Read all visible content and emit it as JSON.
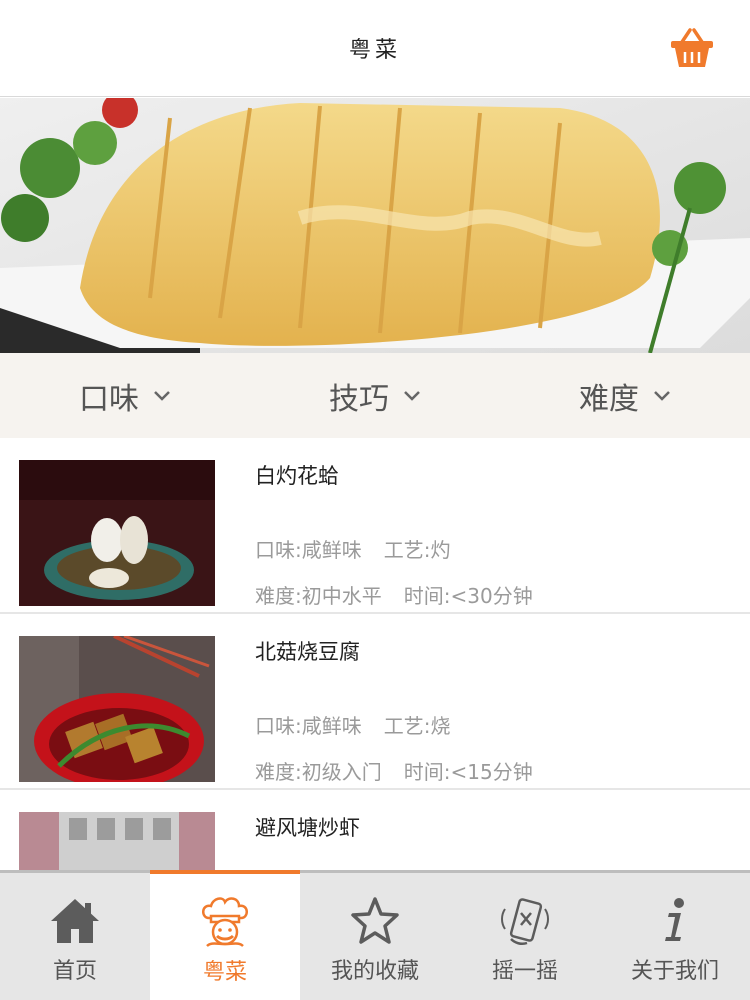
{
  "header": {
    "title": "粤菜",
    "cart_icon": "basket-icon",
    "accent": "#f07a2c"
  },
  "filters": [
    {
      "label": "口味"
    },
    {
      "label": "技巧"
    },
    {
      "label": "难度"
    }
  ],
  "recipes": [
    {
      "name": "白灼花蛤",
      "taste": "口味:咸鲜味",
      "craft": "工艺:灼",
      "difficulty": "难度:初中水平",
      "time": "时间:<30分钟"
    },
    {
      "name": "北菇烧豆腐",
      "taste": "口味:咸鲜味",
      "craft": "工艺:烧",
      "difficulty": "难度:初级入门",
      "time": "时间:<15分钟"
    },
    {
      "name": "避风塘炒虾",
      "taste": "",
      "craft": "",
      "difficulty": "",
      "time": ""
    }
  ],
  "tabs": [
    {
      "label": "首页",
      "icon": "home-icon"
    },
    {
      "label": "粤菜",
      "icon": "chef-icon",
      "active": true
    },
    {
      "label": "我的收藏",
      "icon": "star-icon"
    },
    {
      "label": "摇一摇",
      "icon": "shake-phone-icon"
    },
    {
      "label": "关于我们",
      "icon": "info-icon"
    }
  ]
}
